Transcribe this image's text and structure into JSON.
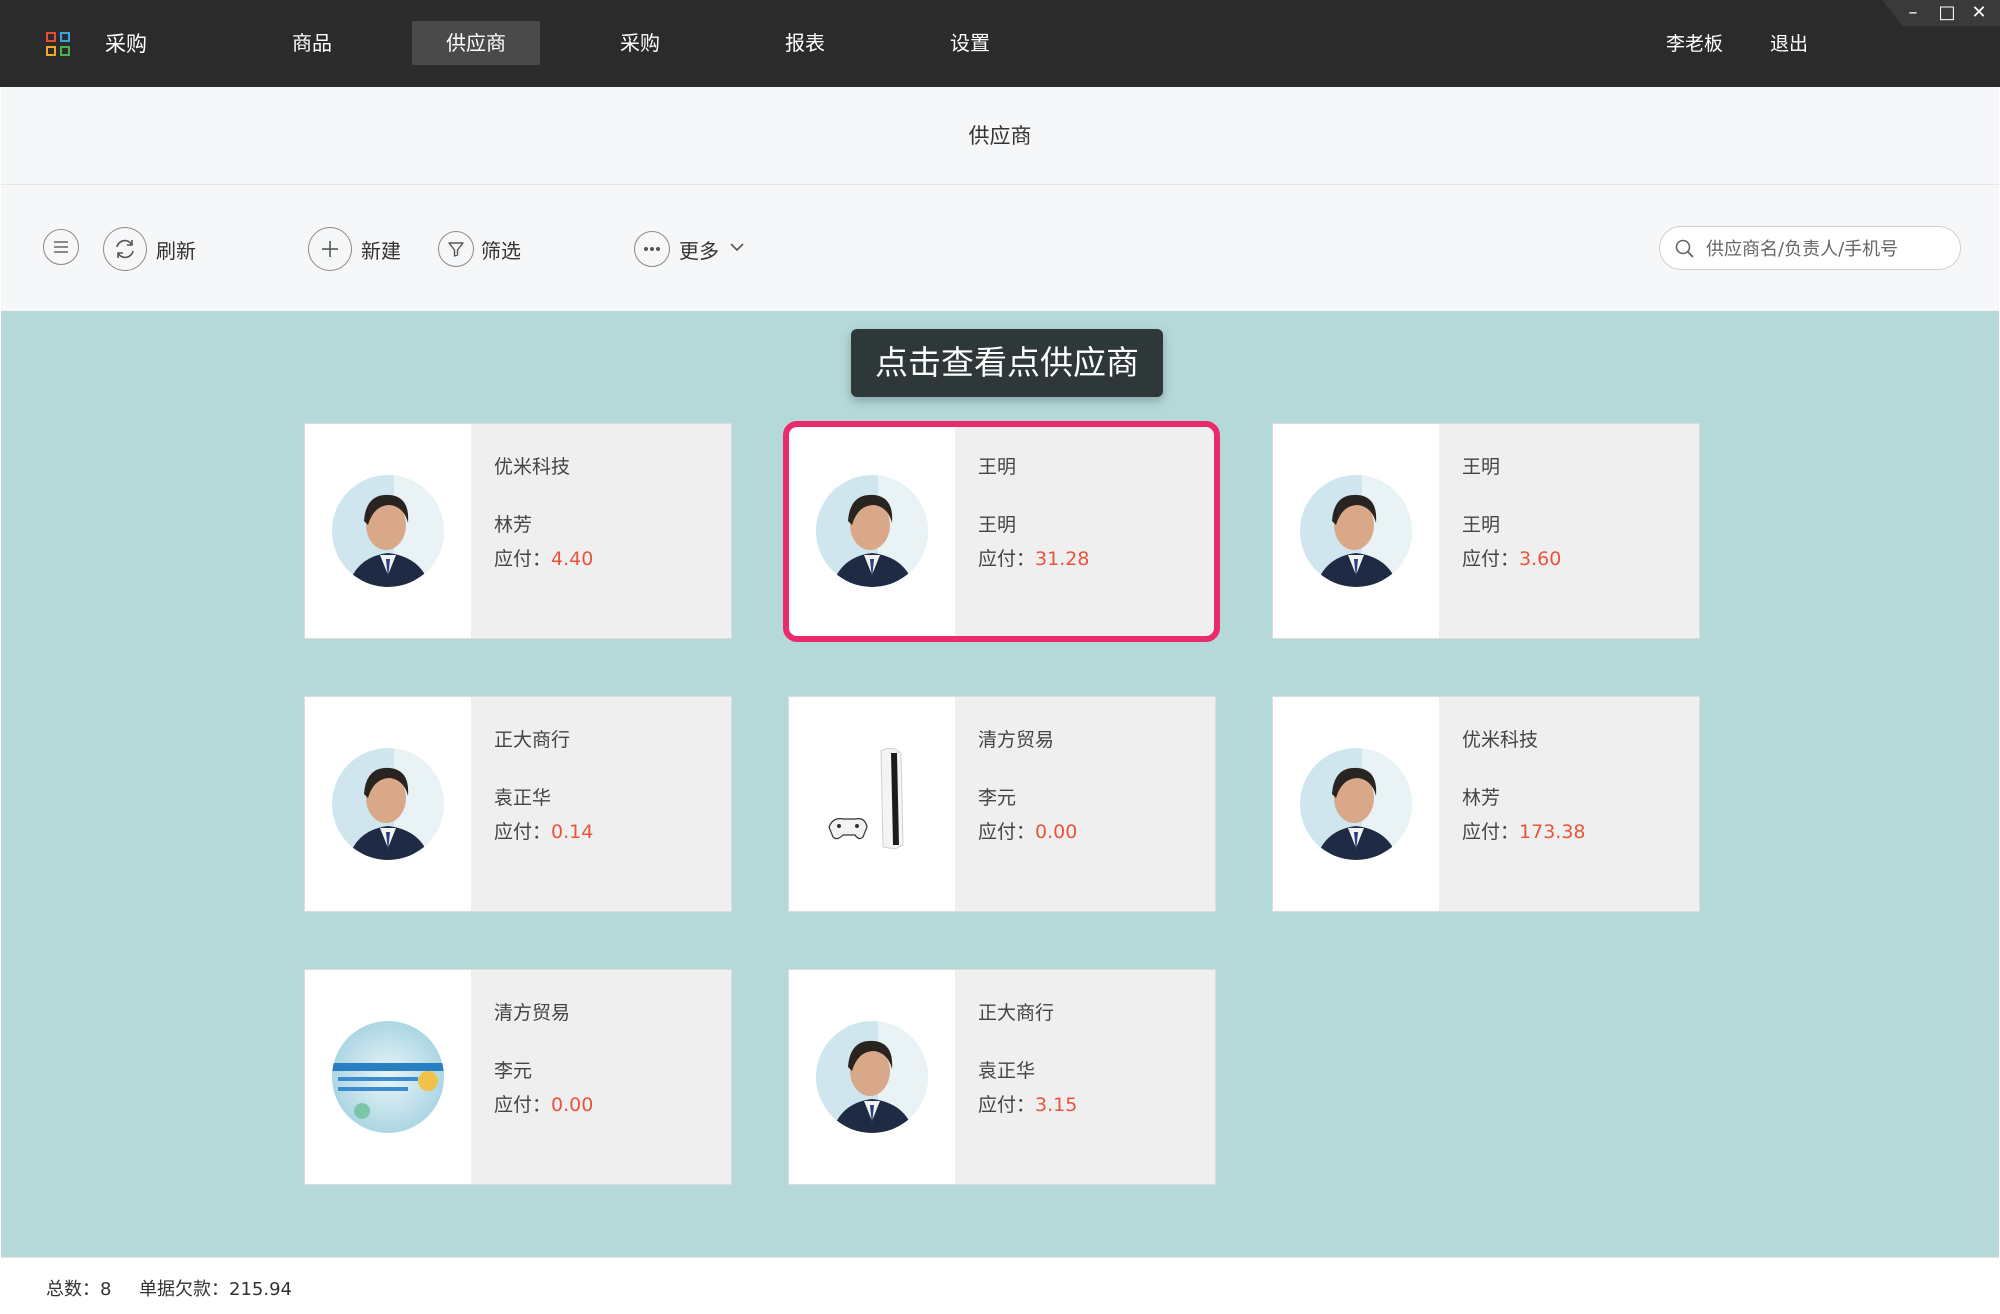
{
  "app": {
    "name": "采购"
  },
  "nav": {
    "items": [
      {
        "label": "商品",
        "active": false
      },
      {
        "label": "供应商",
        "active": true
      },
      {
        "label": "采购",
        "active": false
      },
      {
        "label": "报表",
        "active": false
      },
      {
        "label": "设置",
        "active": false
      }
    ],
    "user": "李老板",
    "logout": "退出"
  },
  "window_controls": {
    "minimize": "–",
    "maximize": "□",
    "close": "✕"
  },
  "page": {
    "title": "供应商"
  },
  "toolbar": {
    "refresh": "刷新",
    "add": "新建",
    "filter": "筛选",
    "more": "更多",
    "search_placeholder": "供应商名/负责人/手机号"
  },
  "tooltip": "点击查看点供应商",
  "due_label": "应付：",
  "suppliers": [
    {
      "name": "优米科技",
      "contact": "林芳",
      "due": "4.40",
      "image": "person"
    },
    {
      "name": "王明",
      "contact": "王明",
      "due": "31.28",
      "image": "person",
      "highlighted": true
    },
    {
      "name": "王明",
      "contact": "王明",
      "due": "3.60",
      "image": "person"
    },
    {
      "name": "正大商行",
      "contact": "袁正华",
      "due": "0.14",
      "image": "person"
    },
    {
      "name": "清方贸易",
      "contact": "李元",
      "due": "0.00",
      "image": "console"
    },
    {
      "name": "优米科技",
      "contact": "林芳",
      "due": "173.38",
      "image": "person"
    },
    {
      "name": "清方贸易",
      "contact": "李元",
      "due": "0.00",
      "image": "ad-banner"
    },
    {
      "name": "正大商行",
      "contact": "袁正华",
      "due": "3.15",
      "image": "person"
    }
  ],
  "footer": {
    "total_label": "总数：",
    "total": "8",
    "debt_label": "单据欠款：",
    "debt": "215.94"
  }
}
